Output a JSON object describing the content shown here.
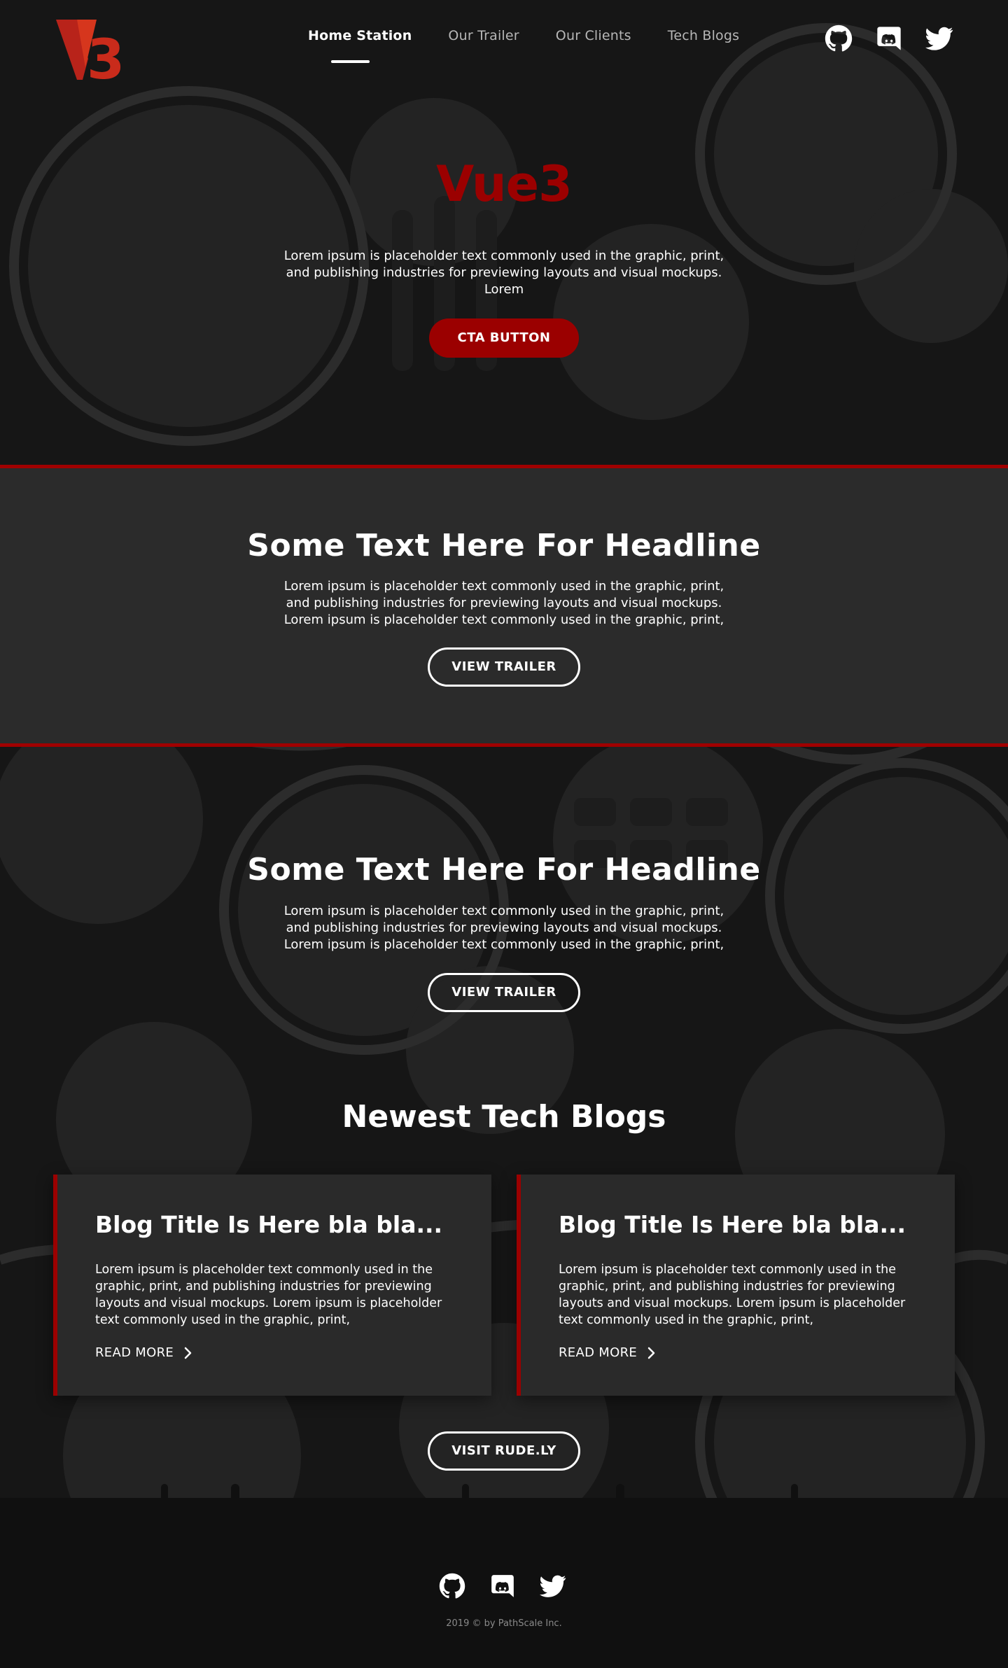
{
  "brand": {
    "logo_text": "V3",
    "logo_colors": [
      "#c4281a",
      "#e8451d"
    ]
  },
  "nav": {
    "items": [
      {
        "label": "Home Station",
        "active": true
      },
      {
        "label": "Our Trailer",
        "active": false
      },
      {
        "label": "Our Clients",
        "active": false
      },
      {
        "label": "Tech Blogs",
        "active": false
      }
    ]
  },
  "social": {
    "icons": [
      "github-icon",
      "discord-icon",
      "twitter-icon"
    ]
  },
  "hero": {
    "title": "Vue3",
    "text": "Lorem ipsum is placeholder text commonly used in the graphic, print, and publishing industries for previewing layouts and visual mockups. Lorem",
    "cta_label": "CTA BUTTON"
  },
  "section1": {
    "headline": "Some Text Here For Headline",
    "text": "Lorem ipsum is placeholder text commonly used in the graphic, print, and publishing industries for previewing layouts and visual mockups. Lorem ipsum is placeholder text commonly used in the graphic, print,",
    "button_label": "VIEW TRAILER"
  },
  "section2": {
    "headline": "Some Text Here For Headline",
    "text": "Lorem ipsum is placeholder text commonly used in the graphic, print, and publishing industries for previewing layouts and visual mockups. Lorem ipsum is placeholder text commonly used in the graphic, print,",
    "button_label": "VIEW TRAILER"
  },
  "blogs": {
    "title": "Newest Tech Blogs",
    "cards": [
      {
        "title": "Blog Title Is Here bla bla...",
        "text": "Lorem ipsum is placeholder text commonly used in the graphic, print, and publishing industries for previewing layouts and visual mockups. Lorem ipsum is placeholder text commonly used in the graphic, print,",
        "read_more": "READ MORE"
      },
      {
        "title": "Blog Title Is Here bla bla...",
        "text": "Lorem ipsum is placeholder text commonly used in the graphic, print, and publishing industries for previewing layouts and visual mockups. Lorem ipsum is placeholder text commonly used in the graphic, print,",
        "read_more": "READ MORE"
      }
    ],
    "visit_label": "VISIT RUDE.LY"
  },
  "footer": {
    "copyright": "2019 © by PathScale Inc."
  },
  "colors": {
    "accent": "#9b0000",
    "background": "#161616",
    "panel": "#2b2b2b",
    "card": "#2a2a2a"
  }
}
